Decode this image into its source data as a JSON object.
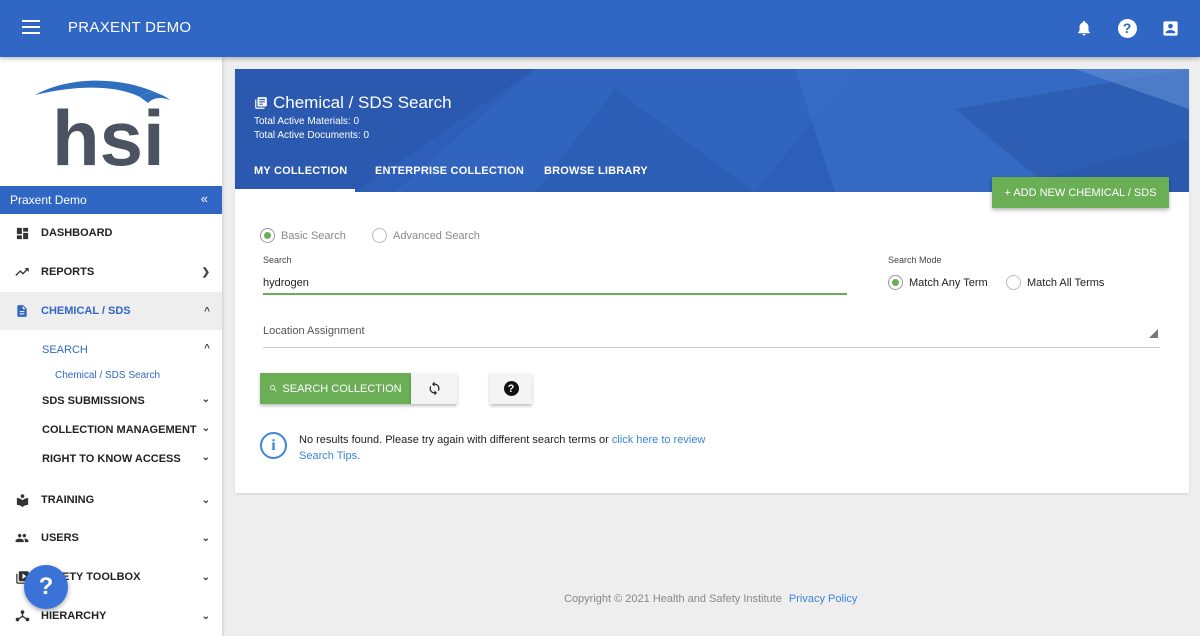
{
  "header": {
    "app_title": "PRAXENT DEMO",
    "icons": [
      "menu-icon",
      "bell-icon",
      "help-icon",
      "account-icon"
    ]
  },
  "sidebar": {
    "logo_text": "hsi",
    "org_name": "Praxent Demo",
    "collapse_label": "«",
    "items": [
      {
        "label": "DASHBOARD",
        "icon": "dashboard-icon"
      },
      {
        "label": "REPORTS",
        "icon": "trending-icon"
      },
      {
        "label": "CHEMICAL / SDS",
        "icon": "document-icon"
      },
      {
        "label": "TRAINING",
        "icon": "book-icon"
      },
      {
        "label": "USERS",
        "icon": "users-icon"
      },
      {
        "label": "SAFETY TOOLBOX",
        "visible_label": "ETY TOOLBOX",
        "icon": "video-library-icon"
      },
      {
        "label": "HIERARCHY",
        "icon": "hierarchy-icon"
      }
    ],
    "chemical_sub": {
      "search": "SEARCH",
      "search_child": "Chemical / SDS Search",
      "submissions": "SDS SUBMISSIONS",
      "collection_mgmt": "COLLECTION MANAGEMENT",
      "right_to_know": "RIGHT TO KNOW ACCESS"
    },
    "fab_label": "?"
  },
  "hero": {
    "title": "Chemical / SDS Search",
    "total_materials": "Total Active Materials: 0",
    "total_documents": "Total Active Documents: 0",
    "tabs": [
      "MY COLLECTION",
      "ENTERPRISE COLLECTION",
      "BROWSE LIBRARY"
    ],
    "active_tab": "MY COLLECTION",
    "add_button": "+ ADD NEW CHEMICAL / SDS"
  },
  "search": {
    "mode_basic": "Basic Search",
    "mode_advanced": "Advanced Search",
    "search_label": "Search",
    "search_value": "hydrogen",
    "search_mode_label": "Search Mode",
    "match_any": "Match Any Term",
    "match_all": "Match All Terms",
    "location_placeholder": "Location Assignment",
    "search_button": "SEARCH COLLECTION",
    "help_button": "?"
  },
  "info": {
    "message": "No results found. Please try again with different search terms or",
    "link_text_1": "click here to review",
    "link_text_2": "Search Tips."
  },
  "footer": {
    "copyright": "Copyright © 2021 Health and Safety Institute",
    "privacy": "Privacy Policy"
  },
  "colors": {
    "primary": "#3066c4",
    "accent_green": "#6aae56",
    "link": "#3a86d8"
  }
}
